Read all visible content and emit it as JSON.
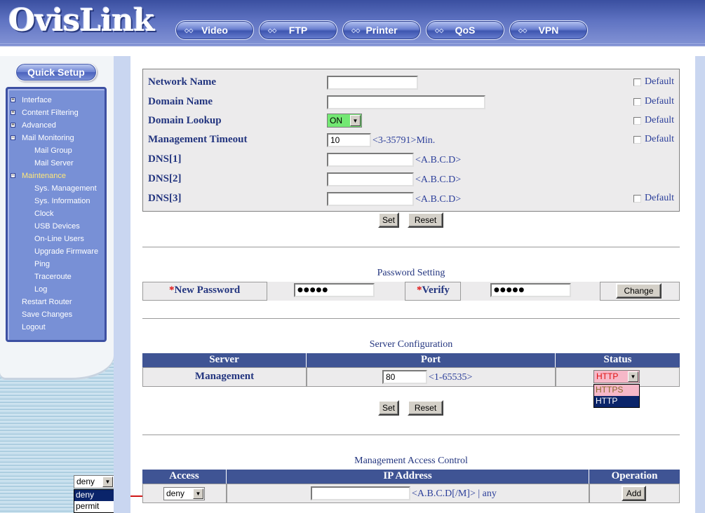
{
  "header": {
    "logo": "OvisLink",
    "nav": [
      "Video",
      "FTP",
      "Printer",
      "QoS",
      "VPN"
    ]
  },
  "sidebar": {
    "quick_setup": "Quick Setup",
    "items": [
      {
        "label": "Interface",
        "toggle": "+"
      },
      {
        "label": "Content Filtering",
        "toggle": "+"
      },
      {
        "label": "Advanced",
        "toggle": "+"
      },
      {
        "label": "Mail Monitoring",
        "toggle": "-"
      },
      {
        "label": "Mail Group",
        "toggle": ""
      },
      {
        "label": "Mail Server",
        "toggle": ""
      },
      {
        "label": "Maintenance",
        "toggle": "-"
      },
      {
        "label": "Sys. Management",
        "toggle": ""
      },
      {
        "label": "Sys. Information",
        "toggle": ""
      },
      {
        "label": "Clock",
        "toggle": ""
      },
      {
        "label": "USB Devices",
        "toggle": ""
      },
      {
        "label": "On-Line Users",
        "toggle": ""
      },
      {
        "label": "Upgrade Firmware",
        "toggle": ""
      },
      {
        "label": "Ping",
        "toggle": ""
      },
      {
        "label": "Traceroute",
        "toggle": ""
      },
      {
        "label": "Log",
        "toggle": ""
      },
      {
        "label": "Restart Router",
        "toggle": ""
      },
      {
        "label": "Save Changes",
        "toggle": ""
      },
      {
        "label": "Logout",
        "toggle": ""
      }
    ],
    "callout_select": {
      "value": "deny",
      "options": [
        "deny",
        "permit"
      ],
      "highlighted": "deny"
    }
  },
  "system": {
    "network_name": {
      "label": "Network Name",
      "value": "",
      "default_label": "Default"
    },
    "domain_name": {
      "label": "Domain Name",
      "value": "",
      "default_label": "Default"
    },
    "domain_lookup": {
      "label": "Domain Lookup",
      "value": "ON",
      "default_label": "Default"
    },
    "mgmt_timeout": {
      "label": "Management Timeout",
      "value": "10",
      "hint": "<3-35791>Min.",
      "default_label": "Default"
    },
    "dns1": {
      "label": "DNS[1]",
      "value": "",
      "hint": "<A.B.C.D>"
    },
    "dns2": {
      "label": "DNS[2]",
      "value": "",
      "hint": "<A.B.C.D>"
    },
    "dns3": {
      "label": "DNS[3]",
      "value": "",
      "hint": "<A.B.C.D>",
      "default_label": "Default"
    },
    "set": "Set",
    "reset": "Reset"
  },
  "password": {
    "title": "Password Setting",
    "star": "*",
    "new_label": "New Password",
    "new_value": "●●●●●",
    "verify_label": "Verify",
    "verify_value": "●●●●●",
    "change": "Change"
  },
  "server": {
    "title": "Server Configuration",
    "headers": [
      "Server",
      "Port",
      "Status"
    ],
    "row": {
      "server": "Management",
      "port": "80",
      "port_hint": "<1-65535>",
      "status": "HTTP"
    },
    "status_options": [
      "HTTPS",
      "HTTP"
    ],
    "set": "Set",
    "reset": "Reset"
  },
  "access": {
    "title": "Management Access Control",
    "headers": [
      "Access",
      "IP Address",
      "Operation"
    ],
    "row": {
      "access": "deny",
      "ip": "",
      "ip_hint": "<A.B.C.D[/M]> | any"
    },
    "add": "Add"
  },
  "colors": {
    "header_blue": "#3a4fa0",
    "table_head": "#3f5494",
    "label_blue": "#23357f",
    "on_green": "#73e873",
    "https_pink": "#f6b8c8",
    "http_red": "#e01010"
  }
}
